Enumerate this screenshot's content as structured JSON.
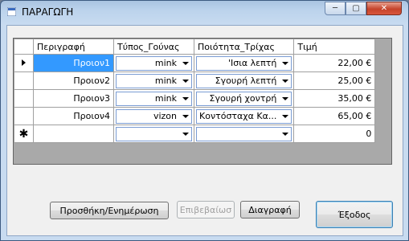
{
  "window": {
    "title": "ΠΑΡΑΓΩΓΗ",
    "minimize": "─",
    "maximize": "▢",
    "close": "✕"
  },
  "grid": {
    "columns": [
      "Περιγραφή",
      "Τύπος_Γούνας",
      "Ποιότητα_Τρίχας",
      "Τιμή"
    ],
    "rows": [
      {
        "descr": "Προιον1",
        "fur": "mink",
        "quality": "'Ισια λεπτή",
        "price": "22,00 €"
      },
      {
        "descr": "Προιον2",
        "fur": "mink",
        "quality": "Σγουρή λεπτή",
        "price": "25,00 €"
      },
      {
        "descr": "Προιον3",
        "fur": "mink",
        "quality": "Σγουρή χοντρή",
        "price": "35,00 €"
      },
      {
        "descr": "Προιον4",
        "fur": "vizon",
        "quality": "Κοντόσταχα Κα...",
        "price": "65,00 €"
      }
    ],
    "new_row": {
      "descr": "",
      "fur": "",
      "quality": "",
      "price": "0",
      "marker": "✱"
    }
  },
  "buttons": {
    "add_update": "Προσθήκη/Ενημέρωση",
    "confirm": "Επιβεβαίωσ",
    "delete": "Διαγραφή",
    "exit": "Έξοδος"
  }
}
